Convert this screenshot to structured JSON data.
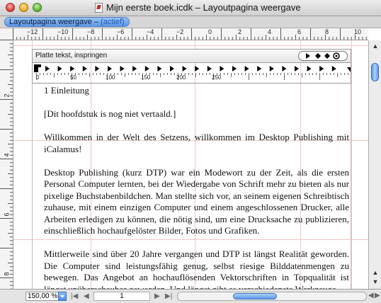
{
  "window": {
    "title": "Mijn eerste boek.icdk – Layoutpagina weergave"
  },
  "tab": {
    "label": "Layoutpagina weergave – ",
    "state": "(actief)"
  },
  "rulers": {
    "horizontal": [
      "−12",
      "−10",
      "−8",
      "−6",
      "−4",
      "−2",
      "0",
      "2",
      "4",
      "6",
      "8",
      "10"
    ],
    "vertical": [
      "2",
      "4",
      "6",
      "8"
    ]
  },
  "text_toolbar": {
    "style_name": "Platte tekst, inspringen",
    "controls": "▶ ◆ ◆ ⊙"
  },
  "tab_ruler": {
    "marks": "◣ ▶ ▶ ▶ ▶ ▶ ▶ ▶ ▶ ▶ ▶ ▶ ▶ ▶ ▶ ▶ ▶ ▶ ▶ ▶ ▶ ▶ ▶ ▶ ▶",
    "scale": [
      "0",
      "50",
      "100",
      "150",
      "200",
      "250"
    ]
  },
  "content": {
    "heading": "1   Einleitung",
    "p1": "[Dit hoofdstuk is nog niet vertaald.]",
    "p2": "Willkommen in der Welt des Setzens, willkommen im Desktop Publishing mit iCalamus!",
    "p3": "Desktop Publishing (kurz DTP) war ein Modewort zu der Zeit, als die ersten Personal Computer lernten, bei der Wiedergabe von Schrift mehr zu bieten als nur pixelige Buchstabenbildchen. Man stellte sich vor, an seinem eigenen Schreibtisch zuhause, mit einem einzigen Computer und einem angeschlossenen Drucker, alle Arbeiten erledigen zu können, die nötig sind, um eine Drucksache zu publizieren, einschließlich hochaufgelöster Bilder, Fotos und Grafiken.",
    "p4": "Mittlerweile sind über 20 Jahre vergangen und DTP ist längst Realität geworden. Die Computer sind leistungsfähig genug, selbst riesige Bilddatenmengen zu bewegen. Das Angebot an hochauflösenden Vektorschriften in Topqualität ist längst unüberschaubar geworden. Und längst gibt es verschiedenste Werkzeuge,"
  },
  "statusbar": {
    "zoom": "150,00 %",
    "page": "1"
  }
}
